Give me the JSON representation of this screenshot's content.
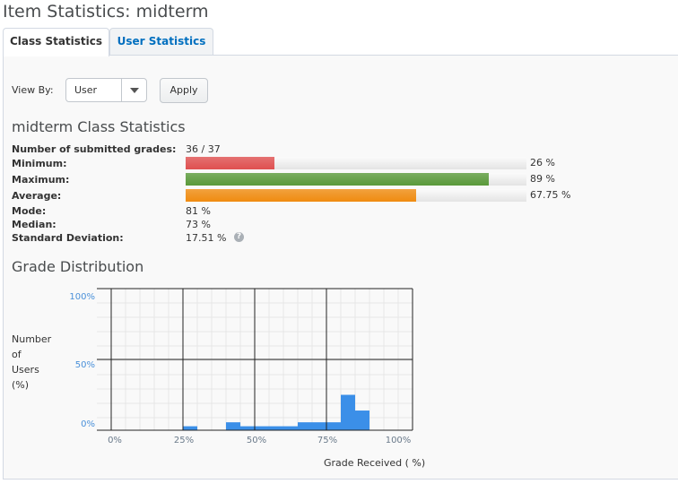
{
  "header": {
    "title": "Item Statistics: midterm"
  },
  "tabs": [
    {
      "label": "Class Statistics",
      "active": true
    },
    {
      "label": "User Statistics",
      "active": false
    }
  ],
  "filter": {
    "label": "View By:",
    "selected": "User",
    "apply_label": "Apply"
  },
  "class_stats": {
    "title": "midterm Class Statistics",
    "submitted_label": "Number of submitted grades:",
    "submitted_value": "36 / 37",
    "min_label": "Minimum:",
    "min_value": "26 %",
    "min_fraction": 0.26,
    "max_label": "Maximum:",
    "max_value": "89 %",
    "max_fraction": 0.89,
    "avg_label": "Average:",
    "avg_value": "67.75 %",
    "avg_fraction": 0.6775,
    "mode_label": "Mode:",
    "mode_value": "81 %",
    "median_label": "Median:",
    "median_value": "73 %",
    "stddev_label": "Standard Deviation:",
    "stddev_value": "17.51 %",
    "help_icon": "?",
    "colors": {
      "min": "#e05050",
      "max": "#5a9a3a",
      "avg": "#f08c10"
    }
  },
  "distribution": {
    "title": "Grade Distribution",
    "ylabel": "Number\nof\nUsers\n(%)",
    "xlabel": "Grade Received ( %)",
    "yticks": [
      "100%",
      "50%",
      "0%"
    ],
    "xticks": [
      "0%",
      "25%",
      "50%",
      "75%",
      "100%"
    ]
  },
  "chart_data": {
    "type": "bar",
    "title": "Grade Distribution",
    "xlabel": "Grade Received ( %)",
    "ylabel": "Number of Users (%)",
    "xlim": [
      0,
      100
    ],
    "ylim": [
      0,
      100
    ],
    "bar_color": "#3b8fe8",
    "bins": [
      {
        "from": 25,
        "to": 30,
        "value": 2.8
      },
      {
        "from": 40,
        "to": 45,
        "value": 5.6
      },
      {
        "from": 45,
        "to": 50,
        "value": 2.8
      },
      {
        "from": 50,
        "to": 55,
        "value": 2.8
      },
      {
        "from": 55,
        "to": 60,
        "value": 2.8
      },
      {
        "from": 60,
        "to": 65,
        "value": 2.8
      },
      {
        "from": 65,
        "to": 70,
        "value": 5.6
      },
      {
        "from": 70,
        "to": 75,
        "value": 5.6
      },
      {
        "from": 75,
        "to": 80,
        "value": 5.6
      },
      {
        "from": 80,
        "to": 85,
        "value": 25.0
      },
      {
        "from": 85,
        "to": 90,
        "value": 13.9
      }
    ]
  }
}
